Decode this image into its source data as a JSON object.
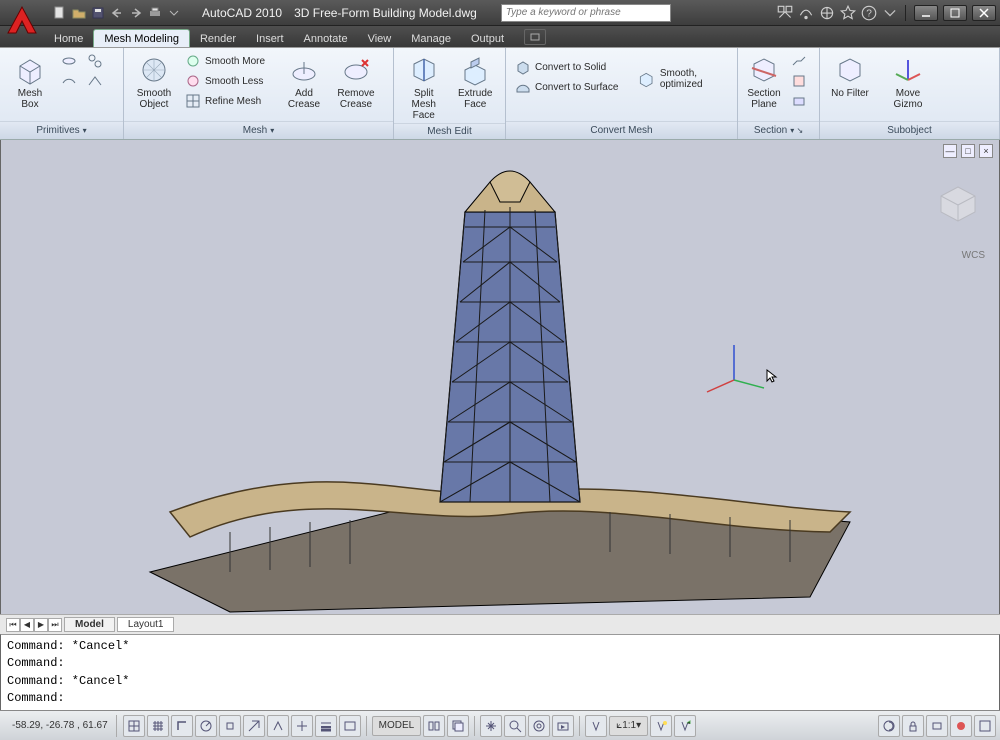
{
  "title": {
    "app": "AutoCAD 2010",
    "file": "3D Free-Form Building Model.dwg"
  },
  "search": {
    "placeholder": "Type a keyword or phrase"
  },
  "menutabs": [
    "Home",
    "Mesh Modeling",
    "Render",
    "Insert",
    "Annotate",
    "View",
    "Manage",
    "Output"
  ],
  "active_tab": "Mesh Modeling",
  "ribbon": {
    "primitives": {
      "title": "Primitives",
      "mesh_box": "Mesh Box"
    },
    "mesh": {
      "title": "Mesh",
      "smooth_object": "Smooth\nObject",
      "smooth_more": "Smooth More",
      "smooth_less": "Smooth Less",
      "refine_mesh": "Refine Mesh",
      "add_crease": "Add\nCrease",
      "remove_crease": "Remove\nCrease"
    },
    "mesh_edit": {
      "title": "Mesh Edit",
      "split": "Split\nMesh Face",
      "extrude": "Extrude\nFace"
    },
    "convert": {
      "title": "Convert Mesh",
      "to_solid": "Convert to Solid",
      "to_surface": "Convert to Surface",
      "smooth_opt": "Smooth, optimized"
    },
    "section": {
      "title": "Section",
      "section_plane": "Section\nPlane"
    },
    "subobject": {
      "title": "Subobject",
      "no_filter": "No Filter",
      "move_gizmo": "Move Gizmo"
    }
  },
  "viewport": {
    "wcs": "WCS"
  },
  "layout_tabs": [
    "Model",
    "Layout1"
  ],
  "active_layout": "Model",
  "command_lines": [
    "Command: *Cancel*",
    "Command:",
    "Command: *Cancel*",
    "Command:"
  ],
  "status": {
    "coords": "-58.29, -26.78 , 61.67",
    "model_label": "MODEL",
    "anno_scale": "1:1"
  }
}
